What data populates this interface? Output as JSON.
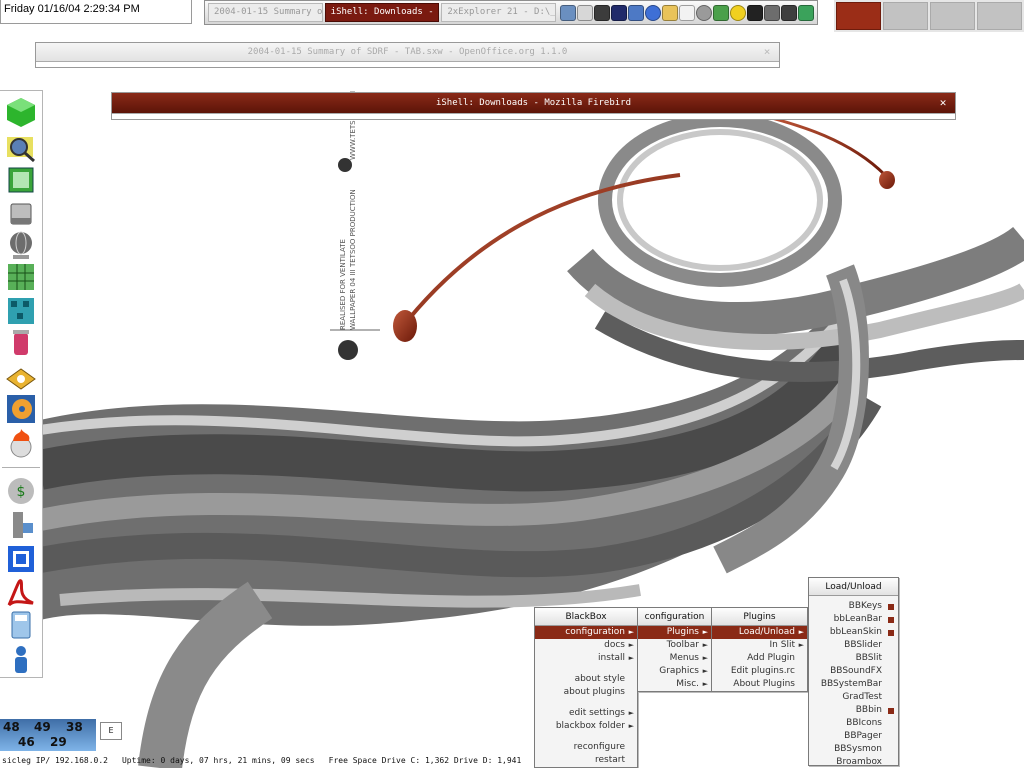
{
  "clock": {
    "text": "Friday 01/16/04 2:29:34 PM"
  },
  "taskbar": {
    "tasks": [
      {
        "label": "2004-01-15 Summary of ..."
      },
      {
        "label": "iShell: Downloads - Mozill..."
      },
      {
        "label": "2xExplorer 21 - D:\\_web..."
      }
    ],
    "tray_icons": [
      "network-icon",
      "printer-icon",
      "window-icon",
      "font-icon",
      "tool-icon",
      "refresh-icon",
      "folder-icon",
      "mail-icon",
      "cd-icon",
      "grid-icon",
      "radiation-icon",
      "media-icon",
      "terminal-icon",
      "screen-icon",
      "recycle-icon"
    ]
  },
  "pager": {
    "desktops": 4,
    "active": 1
  },
  "windows": {
    "openoffice": {
      "title": "2004-01-15 Summary of SDRF - TAB.sxw - OpenOffice.org 1.1.0"
    },
    "firebird": {
      "title": "iShell: Downloads - Mozilla Firebird",
      "close_glyph": "✕"
    }
  },
  "dock": {
    "icons": [
      "cube-icon",
      "magnifier-icon",
      "notebook-icon",
      "disk-icon",
      "globe-icon",
      "spreadsheet-icon",
      "network-blocks-icon",
      "bin-icon",
      "scanner-icon",
      "media-player-icon",
      "fire-cd-icon",
      "money-globe-icon",
      "server-icon",
      "grid-app-icon",
      "acrobat-icon",
      "calculator-icon",
      "person-icon"
    ]
  },
  "meters": {
    "values": [
      "48",
      "49",
      "38",
      "46",
      "29"
    ]
  },
  "small_box": {
    "label": "E"
  },
  "statusline": {
    "host": "sicleg IP/ 192.168.0.2",
    "uptime": "Uptime: 0 days, 07 hrs, 21 mins, 09 secs",
    "free_space": "Free Space Drive C: 1,362 Drive D: 1,941"
  },
  "menus": {
    "blackbox": {
      "title": "BlackBox",
      "items": [
        "configuration",
        "docs",
        "install",
        "about style",
        "about plugins",
        "edit settings",
        "blackbox folder",
        "reconfigure",
        "restart"
      ]
    },
    "configuration": {
      "title": "configuration",
      "items": [
        "Plugins",
        "Toolbar",
        "Menus",
        "Graphics",
        "Misc."
      ]
    },
    "plugins": {
      "title": "Plugins",
      "items": [
        "Load/Unload",
        "In Slit",
        "Add Plugin",
        "Edit plugins.rc",
        "About Plugins"
      ]
    },
    "load_unload": {
      "title": "Load/Unload",
      "items": [
        "BBKeys",
        "bbLeanBar",
        "bbLeanSkin",
        "BBSlider",
        "BBSlit",
        "BBSoundFX",
        "BBSystemBar",
        "GradTest",
        "BBbin",
        "BBIcons",
        "BBPager",
        "BBSysmon",
        "Broambox"
      ]
    }
  },
  "wallpaper": {
    "caption_1": "REALISED FOR VENTILATE",
    "caption_2": "WALLPAPER 04 III TETSOO PRODUCTION",
    "url": "WWW.TETSOO.COM"
  },
  "colors": {
    "accent": "#8a2a16",
    "panel": "#f4f4f4"
  }
}
